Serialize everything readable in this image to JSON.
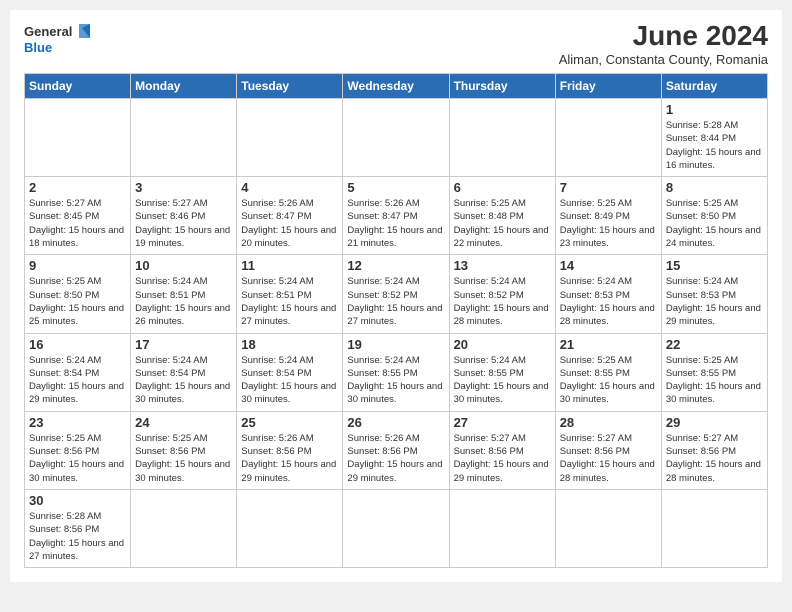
{
  "header": {
    "logo_general": "General",
    "logo_blue": "Blue",
    "month_title": "June 2024",
    "location": "Aliman, Constanta County, Romania"
  },
  "weekdays": [
    "Sunday",
    "Monday",
    "Tuesday",
    "Wednesday",
    "Thursday",
    "Friday",
    "Saturday"
  ],
  "weeks": [
    [
      {
        "day": "",
        "info": ""
      },
      {
        "day": "",
        "info": ""
      },
      {
        "day": "",
        "info": ""
      },
      {
        "day": "",
        "info": ""
      },
      {
        "day": "",
        "info": ""
      },
      {
        "day": "",
        "info": ""
      },
      {
        "day": "1",
        "info": "Sunrise: 5:28 AM\nSunset: 8:44 PM\nDaylight: 15 hours and 16 minutes."
      }
    ],
    [
      {
        "day": "2",
        "info": "Sunrise: 5:27 AM\nSunset: 8:45 PM\nDaylight: 15 hours and 18 minutes."
      },
      {
        "day": "3",
        "info": "Sunrise: 5:27 AM\nSunset: 8:46 PM\nDaylight: 15 hours and 19 minutes."
      },
      {
        "day": "4",
        "info": "Sunrise: 5:26 AM\nSunset: 8:47 PM\nDaylight: 15 hours and 20 minutes."
      },
      {
        "day": "5",
        "info": "Sunrise: 5:26 AM\nSunset: 8:47 PM\nDaylight: 15 hours and 21 minutes."
      },
      {
        "day": "6",
        "info": "Sunrise: 5:25 AM\nSunset: 8:48 PM\nDaylight: 15 hours and 22 minutes."
      },
      {
        "day": "7",
        "info": "Sunrise: 5:25 AM\nSunset: 8:49 PM\nDaylight: 15 hours and 23 minutes."
      },
      {
        "day": "8",
        "info": "Sunrise: 5:25 AM\nSunset: 8:50 PM\nDaylight: 15 hours and 24 minutes."
      }
    ],
    [
      {
        "day": "9",
        "info": "Sunrise: 5:25 AM\nSunset: 8:50 PM\nDaylight: 15 hours and 25 minutes."
      },
      {
        "day": "10",
        "info": "Sunrise: 5:24 AM\nSunset: 8:51 PM\nDaylight: 15 hours and 26 minutes."
      },
      {
        "day": "11",
        "info": "Sunrise: 5:24 AM\nSunset: 8:51 PM\nDaylight: 15 hours and 27 minutes."
      },
      {
        "day": "12",
        "info": "Sunrise: 5:24 AM\nSunset: 8:52 PM\nDaylight: 15 hours and 27 minutes."
      },
      {
        "day": "13",
        "info": "Sunrise: 5:24 AM\nSunset: 8:52 PM\nDaylight: 15 hours and 28 minutes."
      },
      {
        "day": "14",
        "info": "Sunrise: 5:24 AM\nSunset: 8:53 PM\nDaylight: 15 hours and 28 minutes."
      },
      {
        "day": "15",
        "info": "Sunrise: 5:24 AM\nSunset: 8:53 PM\nDaylight: 15 hours and 29 minutes."
      }
    ],
    [
      {
        "day": "16",
        "info": "Sunrise: 5:24 AM\nSunset: 8:54 PM\nDaylight: 15 hours and 29 minutes."
      },
      {
        "day": "17",
        "info": "Sunrise: 5:24 AM\nSunset: 8:54 PM\nDaylight: 15 hours and 30 minutes."
      },
      {
        "day": "18",
        "info": "Sunrise: 5:24 AM\nSunset: 8:54 PM\nDaylight: 15 hours and 30 minutes."
      },
      {
        "day": "19",
        "info": "Sunrise: 5:24 AM\nSunset: 8:55 PM\nDaylight: 15 hours and 30 minutes."
      },
      {
        "day": "20",
        "info": "Sunrise: 5:24 AM\nSunset: 8:55 PM\nDaylight: 15 hours and 30 minutes."
      },
      {
        "day": "21",
        "info": "Sunrise: 5:25 AM\nSunset: 8:55 PM\nDaylight: 15 hours and 30 minutes."
      },
      {
        "day": "22",
        "info": "Sunrise: 5:25 AM\nSunset: 8:55 PM\nDaylight: 15 hours and 30 minutes."
      }
    ],
    [
      {
        "day": "23",
        "info": "Sunrise: 5:25 AM\nSunset: 8:56 PM\nDaylight: 15 hours and 30 minutes."
      },
      {
        "day": "24",
        "info": "Sunrise: 5:25 AM\nSunset: 8:56 PM\nDaylight: 15 hours and 30 minutes."
      },
      {
        "day": "25",
        "info": "Sunrise: 5:26 AM\nSunset: 8:56 PM\nDaylight: 15 hours and 29 minutes."
      },
      {
        "day": "26",
        "info": "Sunrise: 5:26 AM\nSunset: 8:56 PM\nDaylight: 15 hours and 29 minutes."
      },
      {
        "day": "27",
        "info": "Sunrise: 5:27 AM\nSunset: 8:56 PM\nDaylight: 15 hours and 29 minutes."
      },
      {
        "day": "28",
        "info": "Sunrise: 5:27 AM\nSunset: 8:56 PM\nDaylight: 15 hours and 28 minutes."
      },
      {
        "day": "29",
        "info": "Sunrise: 5:27 AM\nSunset: 8:56 PM\nDaylight: 15 hours and 28 minutes."
      }
    ],
    [
      {
        "day": "30",
        "info": "Sunrise: 5:28 AM\nSunset: 8:56 PM\nDaylight: 15 hours and 27 minutes."
      },
      {
        "day": "",
        "info": ""
      },
      {
        "day": "",
        "info": ""
      },
      {
        "day": "",
        "info": ""
      },
      {
        "day": "",
        "info": ""
      },
      {
        "day": "",
        "info": ""
      },
      {
        "day": "",
        "info": ""
      }
    ]
  ]
}
